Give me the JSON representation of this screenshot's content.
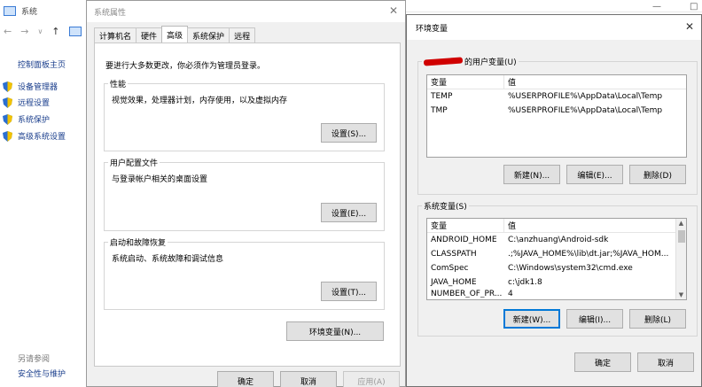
{
  "background": {
    "title": "系统",
    "links": [
      "控制面板主页"
    ],
    "items": [
      "设备管理器",
      "远程设置",
      "系统保护",
      "高级系统设置"
    ],
    "see_also": "另请参阅",
    "security_link": "安全性与维护"
  },
  "sysprop": {
    "title": "系统属性",
    "tabs": [
      "计算机名",
      "硬件",
      "高级",
      "系统保护",
      "远程"
    ],
    "admin_note": "要进行大多数更改，你必须作为管理员登录。",
    "performance": {
      "label": "性能",
      "desc": "视觉效果，处理器计划，内存使用，以及虚拟内存",
      "button": "设置(S)..."
    },
    "profile": {
      "label": "用户配置文件",
      "desc": "与登录帐户相关的桌面设置",
      "button": "设置(E)..."
    },
    "startup": {
      "label": "启动和故障恢复",
      "desc": "系统启动、系统故障和调试信息",
      "button": "设置(T)..."
    },
    "env_button": "环境变量(N)...",
    "ok": "确定",
    "cancel": "取消",
    "apply": "应用(A)"
  },
  "envdlg": {
    "title": "环境变量",
    "user_group_label": "的用户变量(U)",
    "col_var": "变量",
    "col_val": "值",
    "user_vars": [
      {
        "name": "TEMP",
        "value": "%USERPROFILE%\\AppData\\Local\\Temp"
      },
      {
        "name": "TMP",
        "value": "%USERPROFILE%\\AppData\\Local\\Temp"
      }
    ],
    "user_new": "新建(N)...",
    "user_edit": "编辑(E)...",
    "user_delete": "删除(D)",
    "sys_group_label": "系统变量(S)",
    "sys_vars": [
      {
        "name": "ANDROID_HOME",
        "value": "C:\\anzhuang\\Android-sdk"
      },
      {
        "name": "CLASSPATH",
        "value": ".;%JAVA_HOME%\\lib\\dt.jar;%JAVA_HOM..."
      },
      {
        "name": "ComSpec",
        "value": "C:\\Windows\\system32\\cmd.exe"
      },
      {
        "name": "JAVA_HOME",
        "value": "c:\\jdk1.8"
      },
      {
        "name": "NUMBER_OF_PR...",
        "value": "4"
      }
    ],
    "sys_new": "新建(W)...",
    "sys_edit": "编辑(I)...",
    "sys_delete": "删除(L)",
    "ok": "确定",
    "cancel": "取消"
  }
}
